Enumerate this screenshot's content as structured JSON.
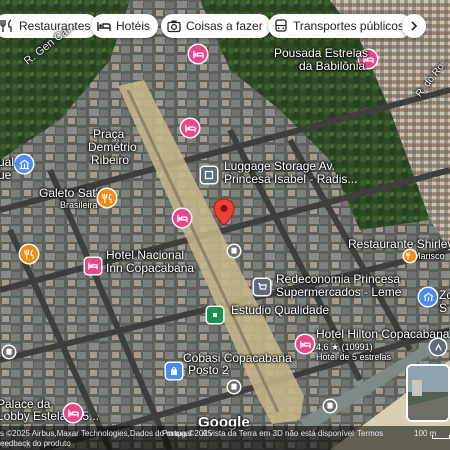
{
  "chips": [
    {
      "label": "Restaurantes",
      "icon": "fork-knife-icon"
    },
    {
      "label": "Hotéis",
      "icon": "bed-icon"
    },
    {
      "label": "Coisas a fazer",
      "icon": "camera-icon"
    },
    {
      "label": "Transportes públicos",
      "icon": "bus-icon"
    }
  ],
  "places": {
    "pousada": "Pousada Estrelas",
    "pousada_2": "da Babilônia",
    "praca_1": "Praça",
    "praca_2": "Demétrio",
    "praca_3": "Ribeiro",
    "galeto": "Galeto Sat's",
    "galeto_sub": "Brasileira",
    "luggage_1": "Luggage Storage Av.",
    "luggage_2": "Princesa Isabel - Radis...",
    "hotel_nacional_1": "Hotel Nacional",
    "hotel_nacional_2": "Inn Copacabana",
    "shirley": "Restaurante Shirley",
    "shirley_sub": "Marisco",
    "princesa_1": "Redeconomia Princesa",
    "princesa_2": "Supermercados - Leme",
    "estudio": "Estúdio Qualidade",
    "hilton": "Hotel Hilton Copacabana",
    "hilton_rating": "4,6 ★ (10991)",
    "hilton_sub": "Hotel de 5 estrelas",
    "cobasi_1": "Cobasi Copacabana",
    "cobasi_2": "Posto 2",
    "palace_1": "Palace da",
    "palace_2": "Lobby Estelar R5...",
    "left_edge_1": "ual",
    "left_edge_2": "ue",
    "right_edge_1": "Zo",
    "right_edge_2": "S"
  },
  "streets": {
    "gen": "R. Gen Ca...",
    "right": "R. do Ro..."
  },
  "attribution": {
    "left": "s ©2025 Airbus,Maxar Technologies,Dados do mapa ©2025",
    "portugal": "Portugal",
    "notice": "A vista da Terra em 3D não está disponível",
    "terms": "Termos",
    "scale": "100 m",
    "feedback": "eedback do produto"
  },
  "logo": "Google",
  "colors": {
    "hotel_pin": "#e9478b",
    "food_pin": "#ef8a1b",
    "service_pin": "#5f6b78",
    "shop_pin": "#1d8f4e",
    "pet_pin": "#4b8bf4",
    "transit_pin": "#6e6e6e",
    "selected_pin": "#ea4335",
    "avenue": "#c8b98a"
  }
}
